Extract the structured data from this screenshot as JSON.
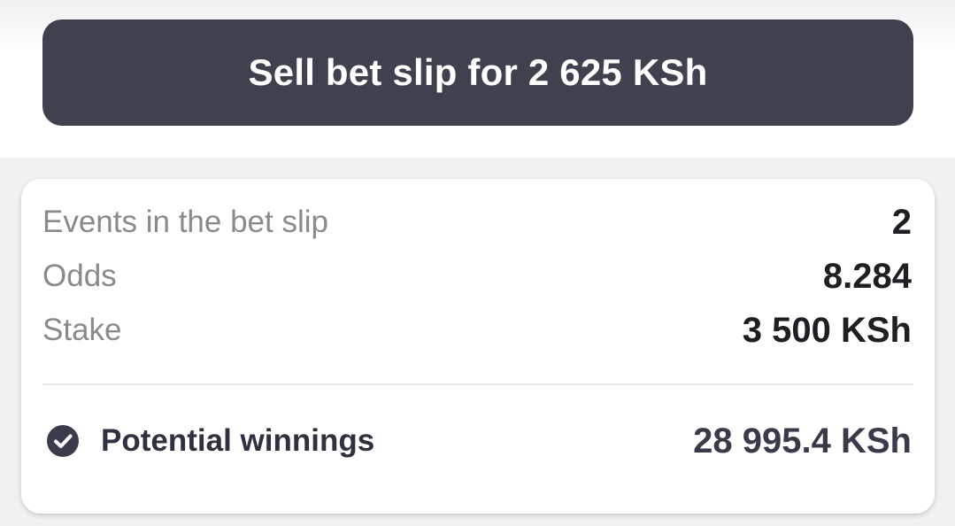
{
  "sell_button": {
    "label": "Sell bet slip for 2 625 KSh"
  },
  "summary": {
    "rows": [
      {
        "label": "Events in the bet slip",
        "value": "2"
      },
      {
        "label": "Odds",
        "value": "8.284"
      },
      {
        "label": "Stake",
        "value": "3 500 KSh"
      }
    ],
    "winnings": {
      "icon": "check-circle-icon",
      "label": "Potential winnings",
      "value": "28 995.4 KSh"
    }
  },
  "colors": {
    "button_bg": "#40414f",
    "page_bg": "#f1f1f3",
    "card_bg": "#ffffff"
  }
}
